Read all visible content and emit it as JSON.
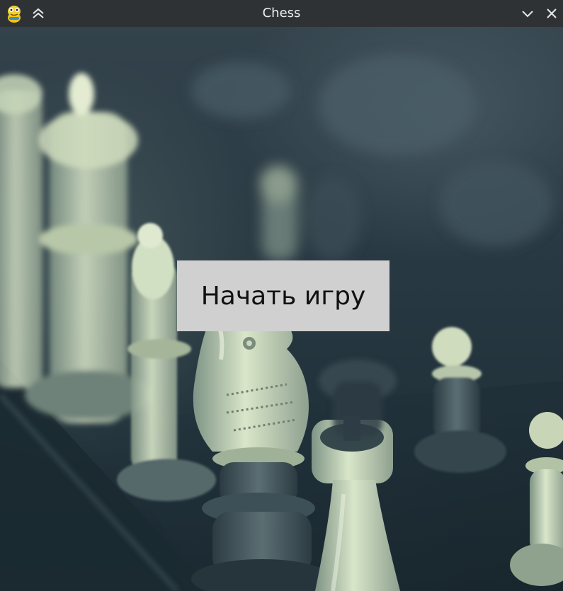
{
  "window": {
    "title": "Chess",
    "app_icon": "pygame-snake-icon",
    "controls": [
      "collapse-up-icon",
      "minimize-chevron-icon",
      "close-icon"
    ]
  },
  "menu": {
    "start_label": "Начать игру"
  },
  "background": {
    "subject": "chess-pieces-photo",
    "tint": "#3b5260"
  }
}
